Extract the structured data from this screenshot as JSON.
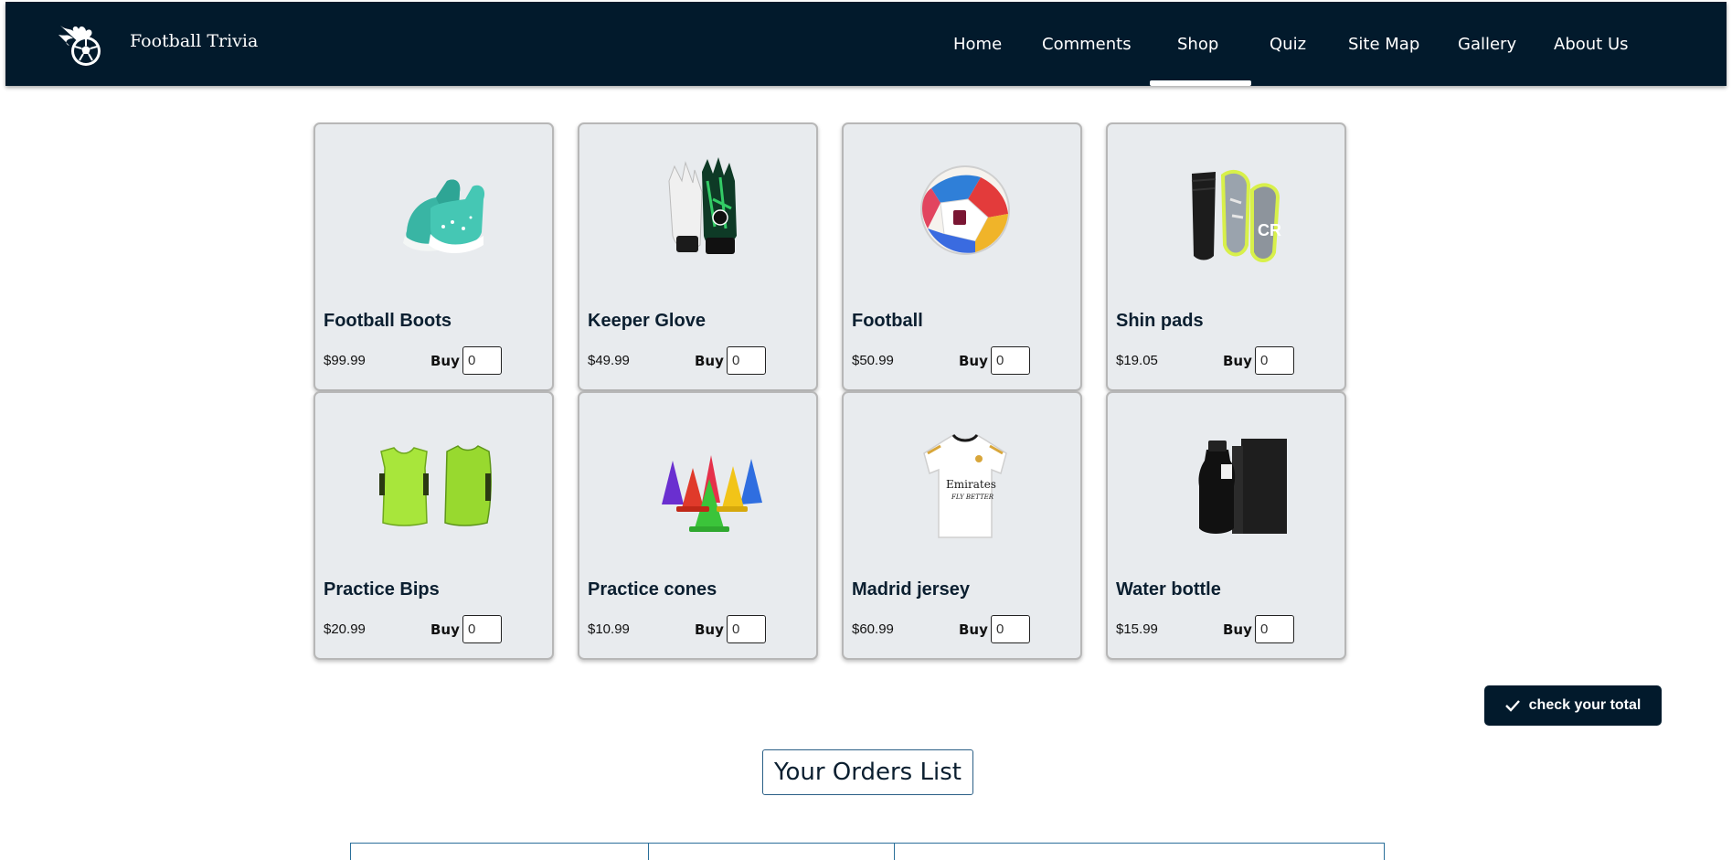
{
  "header": {
    "brand": "Football Trivia",
    "nav": [
      "Home",
      "Comments",
      "Shop",
      "Quiz",
      "Site Map",
      "Gallery",
      "About Us"
    ],
    "active": "Shop"
  },
  "products": [
    {
      "name": "Football Boots",
      "price": "$99.99",
      "buy_label": "Buy",
      "qty": "0",
      "icon": "football-boots-image"
    },
    {
      "name": "Keeper Glove",
      "price": "$49.99",
      "buy_label": "Buy",
      "qty": "0",
      "icon": "keeper-glove-image"
    },
    {
      "name": "Football",
      "price": "$50.99",
      "buy_label": "Buy",
      "qty": "0",
      "icon": "football-image"
    },
    {
      "name": "Shin pads",
      "price": "$19.05",
      "buy_label": "Buy",
      "qty": "0",
      "icon": "shin-pads-image"
    },
    {
      "name": "Practice Bips",
      "price": "$20.99",
      "buy_label": "Buy",
      "qty": "0",
      "icon": "practice-bibs-image"
    },
    {
      "name": "Practice cones",
      "price": "$10.99",
      "buy_label": "Buy",
      "qty": "0",
      "icon": "practice-cones-image"
    },
    {
      "name": "Madrid jersey",
      "price": "$60.99",
      "buy_label": "Buy",
      "qty": "0",
      "icon": "madrid-jersey-image"
    },
    {
      "name": "Water bottle",
      "price": "$15.99",
      "buy_label": "Buy",
      "qty": "0",
      "icon": "water-bottle-image"
    }
  ],
  "actions": {
    "check_total": "check your total"
  },
  "orders": {
    "title": "Your Orders List"
  },
  "colors": {
    "navbar": "#021a2c",
    "card_bg": "#e8ebee",
    "accent_border": "#2a6f9a"
  }
}
